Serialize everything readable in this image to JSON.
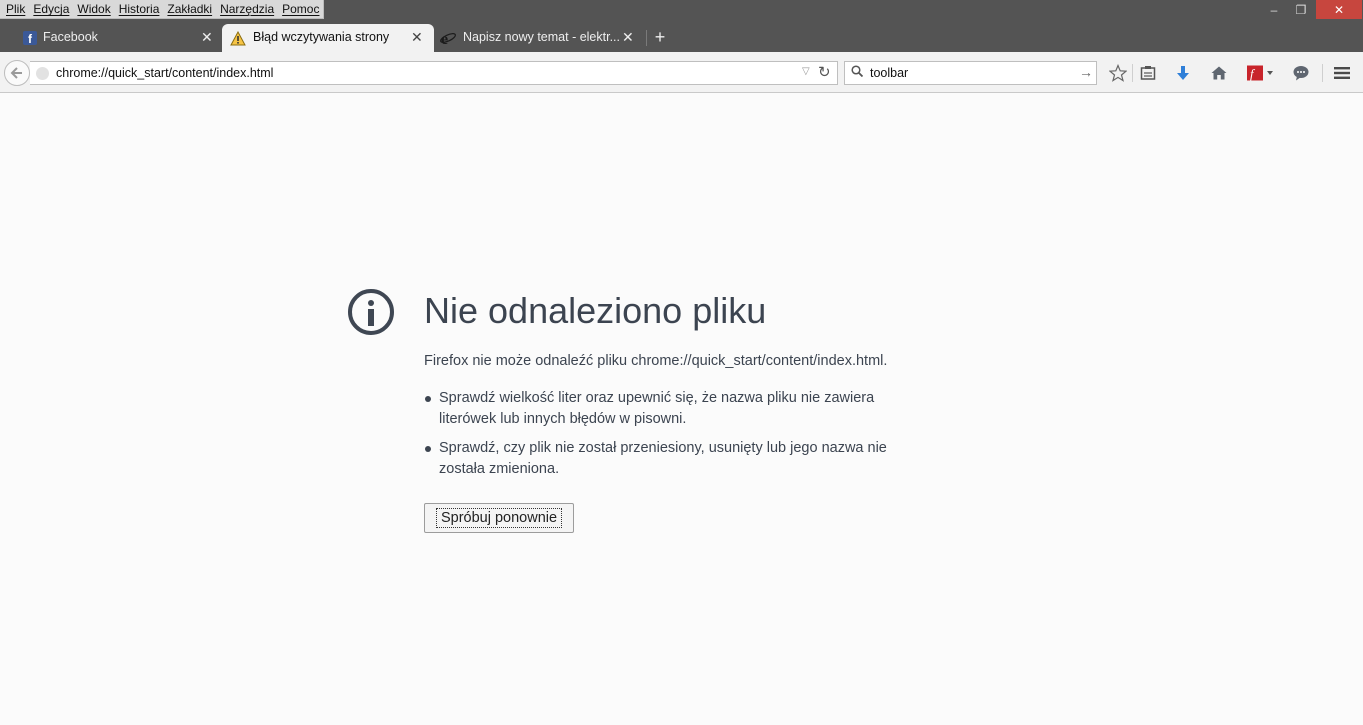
{
  "menu": [
    "Plik",
    "Edycja",
    "Widok",
    "Historia",
    "Zakładki",
    "Narzędzia",
    "Pomoc"
  ],
  "window_controls": {
    "minimize": "–",
    "maximize": "❐",
    "close": "✕"
  },
  "tabs": [
    {
      "title": "Facebook",
      "icon": "facebook-icon",
      "close": "✕"
    },
    {
      "title": "Błąd wczytywania strony",
      "icon": "warning-icon",
      "close": "✕"
    },
    {
      "title": "Napisz nowy temat - elektr...",
      "icon": "ie-icon",
      "close": "✕"
    }
  ],
  "new_tab": "+",
  "navbar": {
    "url": "chrome://quick_start/content/index.html",
    "search_value": "toolbar",
    "icons": [
      "back-icon",
      "reload-icon",
      "search-icon",
      "bookmark-star-icon",
      "reading-list-icon",
      "download-icon",
      "home-icon",
      "flash-icon",
      "chat-icon",
      "menu-icon"
    ]
  },
  "error": {
    "title": "Nie odnaleziono pliku",
    "description": "Firefox nie może odnaleźć pliku chrome://quick_start/content/index.html.",
    "bullets": [
      "Sprawdź wielkość liter oraz upewnić się, że nazwa pliku nie zawiera literówek lub innych błędów w pisowni.",
      "Sprawdź, czy plik nie został przeniesiony, usunięty lub jego nazwa nie została zmieniona."
    ],
    "retry_label": "Spróbuj ponownie"
  }
}
